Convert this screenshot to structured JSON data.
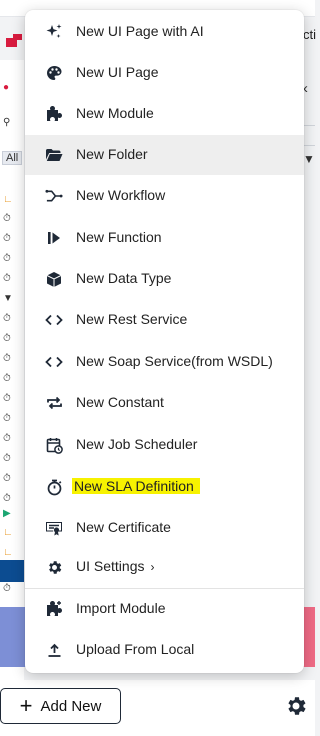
{
  "background": {
    "right_edge_text": "cti",
    "filter_label": "All",
    "add_new_label": "Add New"
  },
  "menu": {
    "items": [
      {
        "label": "New UI Page with AI",
        "icon": "sparkle-icon"
      },
      {
        "label": "New UI Page",
        "icon": "palette-icon"
      },
      {
        "label": "New Module",
        "icon": "puzzle-icon"
      },
      {
        "label": "New Folder",
        "icon": "folder-open-icon",
        "hovered": true
      },
      {
        "label": "New Workflow",
        "icon": "workflow-icon"
      },
      {
        "label": "New Function",
        "icon": "function-icon"
      },
      {
        "label": "New Data Type",
        "icon": "cube-icon"
      },
      {
        "label": "New Rest Service",
        "icon": "code-icon"
      },
      {
        "label": "New Soap Service(from WSDL)",
        "icon": "code-icon"
      },
      {
        "label": "New Constant",
        "icon": "repeat-icon"
      },
      {
        "label": "New Job Scheduler",
        "icon": "calendar-clock-icon"
      },
      {
        "label": "New SLA Definition",
        "icon": "stopwatch-icon",
        "highlighted": true
      },
      {
        "label": "New Certificate",
        "icon": "certificate-icon"
      },
      {
        "label": "UI Settings",
        "icon": "gear-icon",
        "submenu_indicator": "›"
      },
      {
        "label": "Import Module",
        "icon": "puzzle-plus-icon"
      },
      {
        "label": "Upload From Local",
        "icon": "upload-icon"
      }
    ]
  },
  "colors": {
    "highlight": "#f7f200",
    "brand_red": "#d81b3f",
    "selected_row": "#0c4c91"
  }
}
